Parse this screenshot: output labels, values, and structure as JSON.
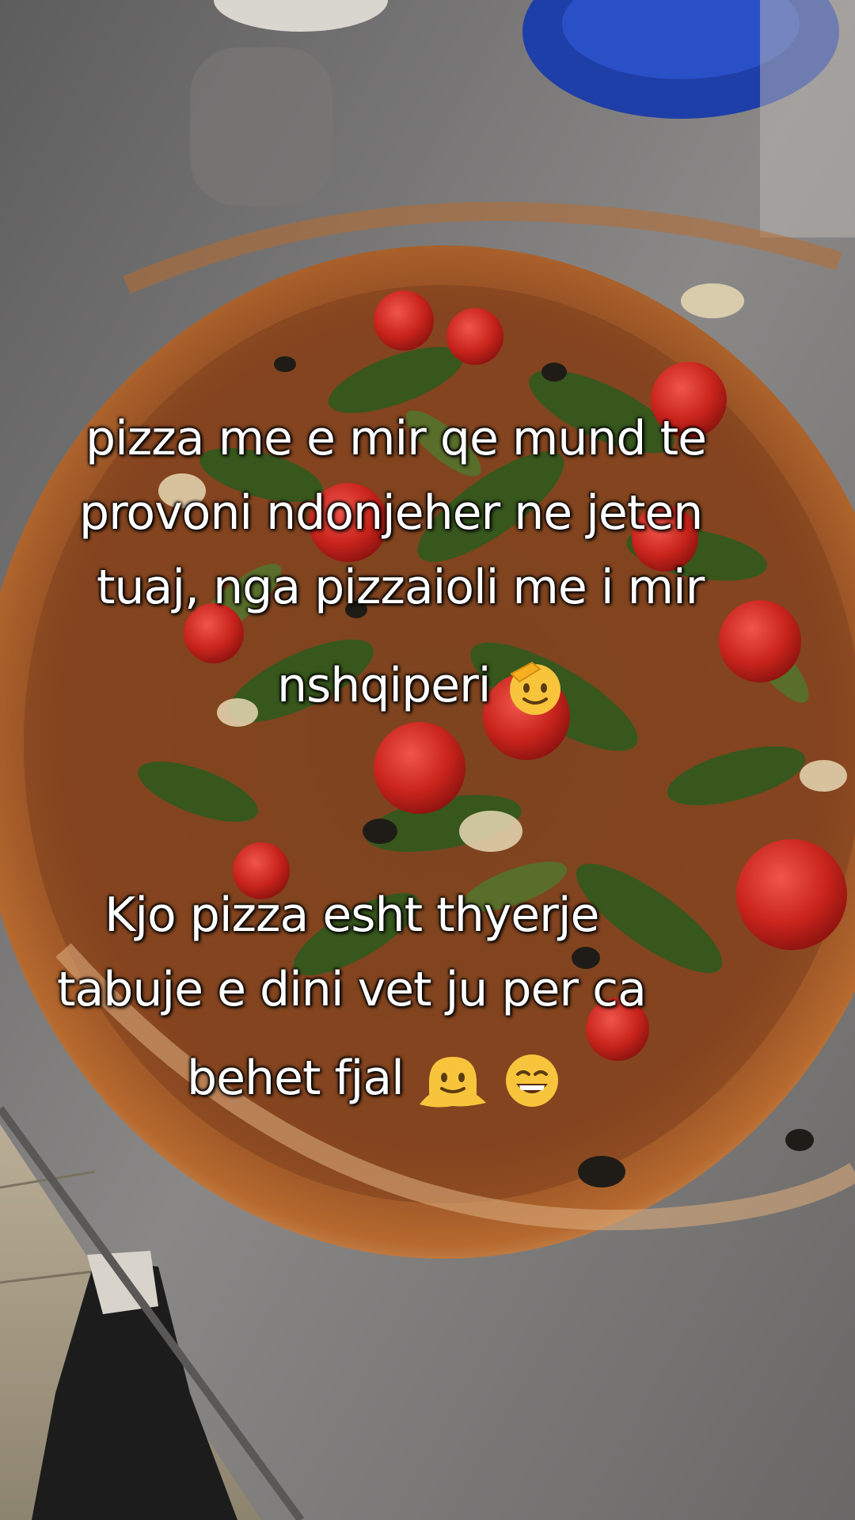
{
  "captions": {
    "block1": {
      "line1": "pizza me e mir qe mund te",
      "line2": "provoni ndonjeher ne jeten",
      "line3": "tuaj, nga pizzaioli me i mir",
      "line4": "nshqiperi"
    },
    "block2": {
      "line1": "Kjo pizza esht thyerje",
      "line2": "tabuje e dini vet ju per ca",
      "line3": "behet fjal"
    }
  },
  "emojis": {
    "block1": [
      "saluting-face-emoji"
    ],
    "block2": [
      "melting-face-emoji",
      "grinning-squinting-face-emoji"
    ]
  },
  "colors": {
    "caption_text": "#ffffff",
    "table": "#8a8887",
    "crust": "#b5692e",
    "tomato": "#c8241c",
    "arugula": "#2f5a1e"
  }
}
